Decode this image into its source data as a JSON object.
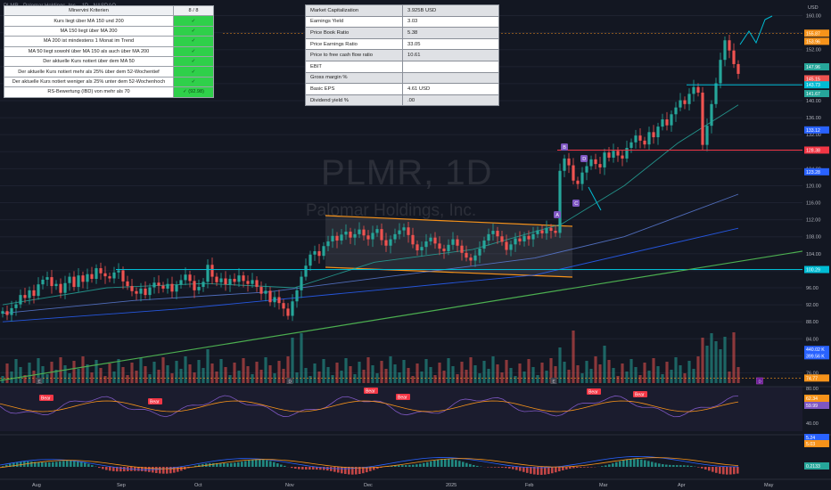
{
  "header": {
    "title": "PLMR · Palomar Holdings, Inc. · 1D · NASDAQ"
  },
  "watermark": {
    "symbol": "PLMR, 1D",
    "company": "Palomar Holdings, Inc."
  },
  "criteria": {
    "header": {
      "label": "Minervini Kriterien",
      "value": "8 / 8"
    },
    "rows": [
      {
        "label": "Kurs liegt über MA 150 und 200",
        "value": "✓"
      },
      {
        "label": "MA 150 liegt über MA 200",
        "value": "✓"
      },
      {
        "label": "MA 200 ist mindestens 1 Monat im Trend",
        "value": "✓"
      },
      {
        "label": "MA 50 liegt sowohl über MA 150 als auch über MA 200",
        "value": "✓"
      },
      {
        "label": "Der aktuelle Kurs notiert über dem MA 50",
        "value": "✓"
      },
      {
        "label": "Der aktuelle Kurs notiert mehr als 25% über dem 52-Wochentief",
        "value": "✓"
      },
      {
        "label": "Der aktuelle Kurs notiert weniger als 25% unter dem 52-Wochenhoch",
        "value": "✓"
      },
      {
        "label": "RS-Bewertung (IBD) von mehr als 70",
        "value": "✓ (92.98)"
      }
    ]
  },
  "fundamentals": [
    {
      "label": "Market Capitalization",
      "value": "3.925B  USD"
    },
    {
      "label": "Earnings Yield",
      "value": "3.03"
    },
    {
      "label": "Price Book Ratio",
      "value": "5.38"
    },
    {
      "label": "Price Earnings Ratio",
      "value": "33.05"
    },
    {
      "label": "Price to free cash flow ratio",
      "value": "10.61"
    },
    {
      "label": "EBIT",
      "value": ""
    },
    {
      "label": "Gross margin %",
      "value": ""
    },
    {
      "label": "Basic EPS",
      "value": "4.61  USD"
    },
    {
      "label": "Dividend yield %",
      "value": ".00"
    }
  ],
  "chart_data": {
    "type": "candlestick",
    "price_axis": {
      "ticks": [
        "160.00",
        "156.00",
        "152.00",
        "148.00",
        "144.00",
        "140.00",
        "136.00",
        "132.00",
        "128.00",
        "124.00",
        "120.00",
        "116.00",
        "112.00",
        "108.00",
        "104.00",
        "100.00",
        "96.00",
        "92.00",
        "88.00",
        "84.00",
        "80.00",
        "76.00"
      ],
      "range": [
        74,
        162
      ]
    },
    "time_axis": {
      "labels": [
        "Aug",
        "Sep",
        "Oct",
        "Nov",
        "Dec",
        "2025",
        "Feb",
        "Mar",
        "Apr",
        "May"
      ]
    },
    "price_labels": [
      {
        "text": "155.87",
        "value": 155.87,
        "color": "#f7931a"
      },
      {
        "text": "153.96",
        "value": 153.96,
        "color": "#f7931a",
        "tag": "Ho"
      },
      {
        "text": "147.96",
        "value": 147.96,
        "color": "#26a69a"
      },
      {
        "text": "145.15",
        "value": 145.15,
        "color": "#ef5350"
      },
      {
        "text": "143.73",
        "value": 143.73,
        "color": "#00bcd4"
      },
      {
        "text": "141.67",
        "value": 141.67,
        "color": "#26a69a"
      },
      {
        "text": "133.12",
        "value": 133.12,
        "color": "#2962ff"
      },
      {
        "text": "128.38",
        "value": 128.38,
        "color": "#f23645"
      },
      {
        "text": "123.28",
        "value": 123.28,
        "color": "#2962ff"
      },
      {
        "text": "100.29",
        "value": 100.29,
        "color": "#00bcd4"
      },
      {
        "text": "440.02 K",
        "value": 81.5,
        "color": "#2962ff"
      },
      {
        "text": "399.56 K",
        "value": 80.0,
        "color": "#2962ff"
      },
      {
        "text": "74.77",
        "value": 74.77,
        "color": "#f7931a"
      }
    ],
    "pattern_labels": [
      "A",
      "B",
      "C",
      "D"
    ],
    "rsi_pane": {
      "ticks": [
        "80.00",
        "60.00",
        "40.00"
      ],
      "labels": [
        {
          "text": "62.34",
          "color": "#f7931a"
        },
        {
          "text": "59.99",
          "color": "#7e57c2"
        }
      ],
      "bear_signals": 6,
      "bear_text": "Bear"
    },
    "macd_pane": {
      "labels": [
        {
          "text": "5.24",
          "color": "#2962ff"
        },
        {
          "text": "5.03",
          "color": "#f7931a"
        },
        {
          "text": "0.2133",
          "color": "#26a69a"
        }
      ]
    },
    "markers": [
      "E",
      "D",
      "E",
      "D"
    ],
    "currency_label": "USD",
    "series": [
      {
        "name": "price",
        "points": [
          [
            3,
            90.5
          ],
          [
            8,
            89.6
          ],
          [
            13,
            91.2
          ],
          [
            18,
            92.1
          ],
          [
            23,
            94.3
          ],
          [
            28,
            93.6
          ],
          [
            33,
            95.4
          ],
          [
            38,
            94.1
          ],
          [
            43,
            96.8
          ],
          [
            48,
            97.9
          ],
          [
            53,
            98.5
          ],
          [
            58,
            96.4
          ],
          [
            63,
            96.9
          ],
          [
            68,
            94.8
          ],
          [
            73,
            97.1
          ],
          [
            78,
            98.6
          ],
          [
            83,
            96.2
          ],
          [
            88,
            98.9
          ],
          [
            93,
            97.4
          ],
          [
            98,
            99.2
          ],
          [
            103,
            98.1
          ],
          [
            108,
            100.6
          ],
          [
            113,
            99.4
          ],
          [
            118,
            98.7
          ],
          [
            123,
            98.2
          ],
          [
            128,
            99.6
          ],
          [
            133,
            100.1
          ],
          [
            138,
            97.5
          ],
          [
            143,
            96.4
          ],
          [
            148,
            95.2
          ],
          [
            153,
            94.6
          ],
          [
            158,
            95.8
          ],
          [
            163,
            94.3
          ],
          [
            168,
            96.1
          ],
          [
            173,
            97.2
          ],
          [
            178,
            96.5
          ],
          [
            183,
            95.8
          ],
          [
            188,
            96.9
          ],
          [
            193,
            95.1
          ],
          [
            198,
            96.7
          ],
          [
            203,
            97.8
          ],
          [
            208,
            99.1
          ],
          [
            213,
            97.6
          ],
          [
            218,
            95.4
          ],
          [
            223,
            96.2
          ],
          [
            228,
            97.4
          ],
          [
            233,
            101.4
          ],
          [
            238,
            98.6
          ],
          [
            243,
            97.3
          ],
          [
            248,
            98.2
          ],
          [
            253,
            96.8
          ],
          [
            258,
            98.1
          ],
          [
            263,
            97.4
          ],
          [
            268,
            98.9
          ],
          [
            273,
            97.6
          ],
          [
            278,
            96.9
          ],
          [
            283,
            97.8
          ],
          [
            288,
            96.2
          ],
          [
            293,
            94.6
          ],
          [
            298,
            95.3
          ],
          [
            303,
            92.6
          ],
          [
            308,
            93.8
          ],
          [
            313,
            92.4
          ],
          [
            318,
            91.1
          ],
          [
            323,
            89.4
          ],
          [
            328,
            92.8
          ],
          [
            333,
            95.4
          ],
          [
            338,
            98.6
          ],
          [
            343,
            101.2
          ],
          [
            348,
            103.8
          ],
          [
            353,
            104.6
          ],
          [
            358,
            103.5
          ],
          [
            363,
            105.8
          ],
          [
            368,
            106.9
          ],
          [
            373,
            108.2
          ],
          [
            378,
            107.1
          ],
          [
            383,
            108.5
          ],
          [
            388,
            109.2
          ],
          [
            393,
            107.8
          ],
          [
            398,
            108.6
          ],
          [
            403,
            109.7
          ],
          [
            408,
            108.3
          ],
          [
            413,
            107.4
          ],
          [
            418,
            108.9
          ],
          [
            423,
            109.8
          ],
          [
            428,
            107.2
          ],
          [
            433,
            105.9
          ],
          [
            438,
            107.4
          ],
          [
            443,
            108.6
          ],
          [
            448,
            109.5
          ],
          [
            453,
            110.2
          ],
          [
            458,
            108.4
          ],
          [
            463,
            106.2
          ],
          [
            468,
            104.8
          ],
          [
            473,
            105.6
          ],
          [
            478,
            106.9
          ],
          [
            483,
            107.8
          ],
          [
            488,
            106.4
          ],
          [
            493,
            105.2
          ],
          [
            498,
            104.6
          ],
          [
            503,
            106.1
          ],
          [
            508,
            107.4
          ],
          [
            513,
            105.9
          ],
          [
            518,
            104.2
          ],
          [
            523,
            103.1
          ],
          [
            528,
            102.4
          ],
          [
            533,
            103.6
          ],
          [
            538,
            105.2
          ],
          [
            543,
            107.1
          ],
          [
            548,
            108.6
          ],
          [
            553,
            109.4
          ],
          [
            558,
            108.1
          ],
          [
            563,
            106.8
          ],
          [
            568,
            104.9
          ],
          [
            573,
            106.2
          ],
          [
            578,
            107.6
          ],
          [
            583,
            106.9
          ],
          [
            588,
            108.2
          ],
          [
            593,
            107.4
          ],
          [
            598,
            108.6
          ],
          [
            603,
            109.5
          ],
          [
            608,
            108.8
          ],
          [
            613,
            110.1
          ],
          [
            618,
            109.4
          ],
          [
            623,
            108.9
          ],
          [
            628,
            123.5
          ],
          [
            633,
            126.4
          ],
          [
            638,
            124.8
          ],
          [
            643,
            121.2
          ],
          [
            648,
            120.4
          ],
          [
            653,
            123.1
          ],
          [
            658,
            124.6
          ],
          [
            663,
            126.2
          ],
          [
            668,
            125.1
          ],
          [
            673,
            124.3
          ],
          [
            678,
            127.8
          ],
          [
            683,
            126.6
          ],
          [
            688,
            128.2
          ],
          [
            693,
            127.1
          ],
          [
            698,
            126.4
          ],
          [
            703,
            128.9
          ],
          [
            708,
            130.2
          ],
          [
            713,
            131.8
          ],
          [
            718,
            130.6
          ],
          [
            723,
            129.7
          ],
          [
            728,
            132.6
          ],
          [
            733,
            131.4
          ],
          [
            738,
            133.9
          ],
          [
            743,
            135.6
          ],
          [
            748,
            134.2
          ],
          [
            753,
            136.8
          ],
          [
            758,
            138.4
          ],
          [
            763,
            140.1
          ],
          [
            768,
            139.2
          ],
          [
            773,
            141.6
          ],
          [
            778,
            143.2
          ],
          [
            783,
            141.9
          ],
          [
            788,
            129.6
          ],
          [
            793,
            134.1
          ],
          [
            798,
            139.2
          ],
          [
            803,
            144.1
          ],
          [
            808,
            149.6
          ],
          [
            813,
            154.2
          ],
          [
            818,
            151.8
          ],
          [
            823,
            148.6
          ],
          [
            828,
            146.3
          ]
        ]
      },
      {
        "name": "MA 50",
        "points": [
          [
            3,
            92
          ],
          [
            120,
            96
          ],
          [
            230,
            97
          ],
          [
            330,
            96
          ],
          [
            420,
            102
          ],
          [
            530,
            105
          ],
          [
            630,
            111
          ],
          [
            700,
            120
          ],
          [
            760,
            130
          ],
          [
            828,
            139
          ]
        ]
      },
      {
        "name": "MA 150",
        "points": [
          [
            3,
            90
          ],
          [
            150,
            93
          ],
          [
            300,
            95
          ],
          [
            450,
            99
          ],
          [
            600,
            103
          ],
          [
            700,
            108
          ],
          [
            828,
            118
          ]
        ]
      },
      {
        "name": "MA 200",
        "points": [
          [
            3,
            88
          ],
          [
            200,
            91
          ],
          [
            400,
            95
          ],
          [
            600,
            99
          ],
          [
            828,
            110
          ]
        ]
      }
    ]
  }
}
